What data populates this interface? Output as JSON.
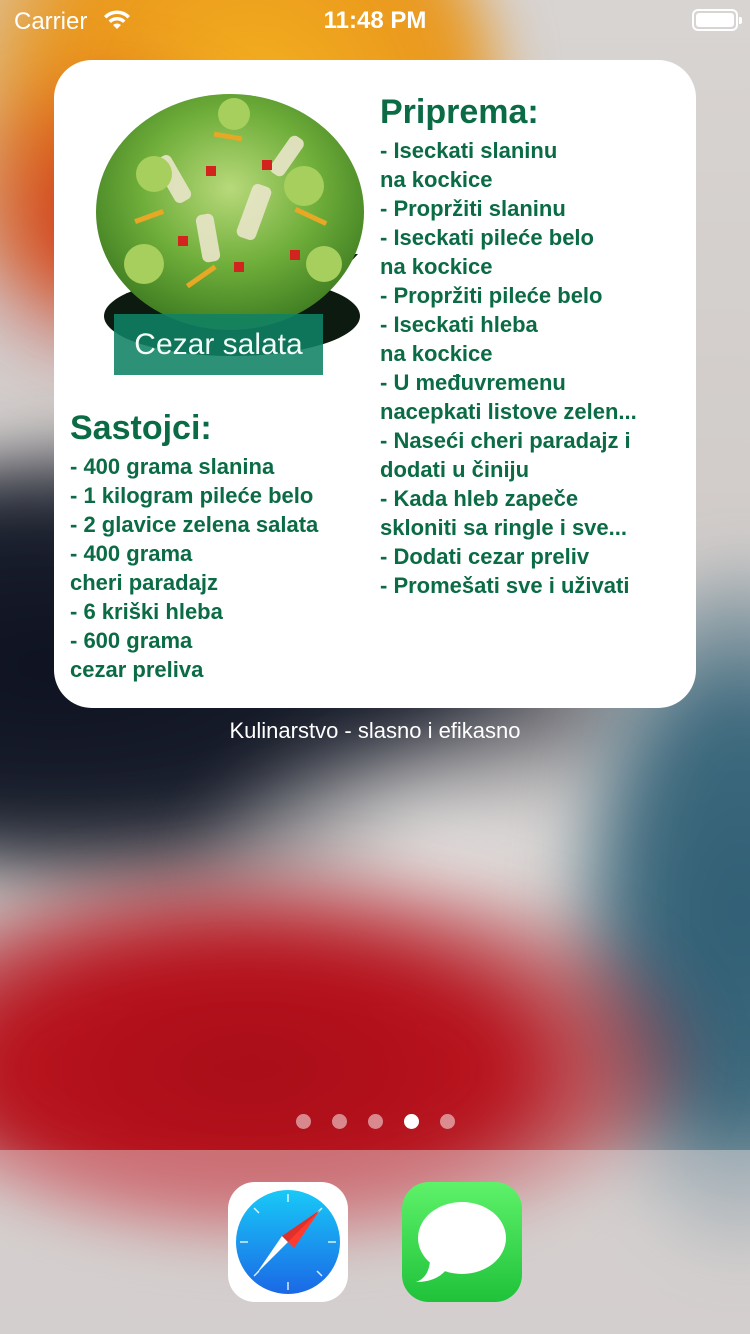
{
  "status_bar": {
    "carrier": "Carrier",
    "time": "11:48 PM"
  },
  "widget": {
    "dish_name": "Cezar salata",
    "ingredients": {
      "title": "Sastojci:",
      "lines": [
        "- 400 grama slanina",
        "- 1 kilogram pileće belo",
        "- 2 glavice zelena salata",
        "- 400 grama",
        "cheri paradajz",
        "- 6 kriški hleba",
        "- 600 grama",
        "cezar preliva"
      ]
    },
    "steps": {
      "title": "Priprema:",
      "lines": [
        "- Iseckati slaninu",
        "na kockice",
        "- Propržiti slaninu",
        "- Iseckati pileće belo",
        "na kockice",
        "- Propržiti pileće belo",
        "- Iseckati hleba",
        "na kockice",
        "- U međuvremenu",
        "nacepkati listove zelen...",
        "- Naseći cheri paradajz i",
        "dodati u činiju",
        "- Kada hleb zapeče",
        "skloniti sa ringle i sve...",
        "- Dodati cezar preliv",
        "- Promešati sve i uživati"
      ]
    },
    "caption": "Kulinarstvo - slasno i efikasno"
  },
  "page_dots": {
    "count": 5,
    "active_index": 3
  },
  "dock": {
    "apps": [
      {
        "icon": "safari-icon"
      },
      {
        "icon": "messages-icon"
      }
    ]
  },
  "colors": {
    "accent_green": "#0a6b45",
    "label_bg": "#10826e"
  }
}
